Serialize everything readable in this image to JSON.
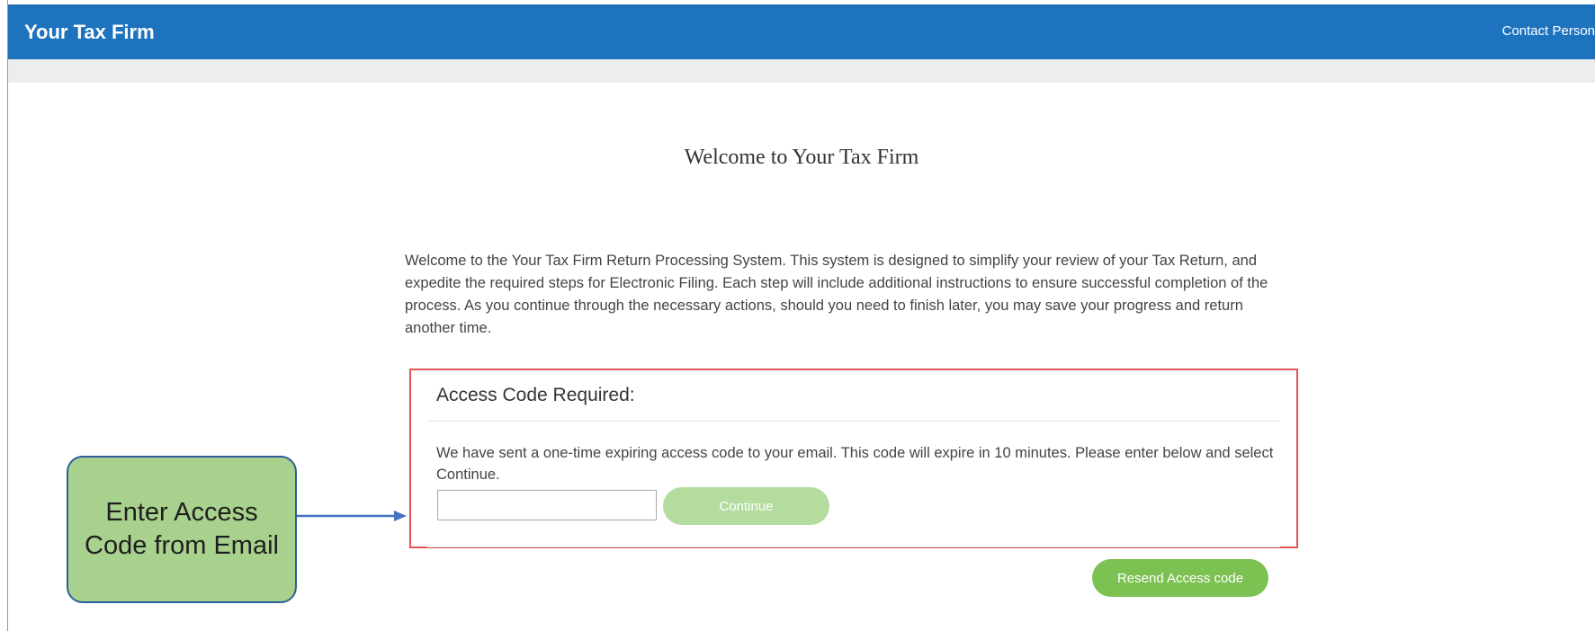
{
  "header": {
    "brand": "Your Tax Firm",
    "contact_link": "Contact Person"
  },
  "main": {
    "title": "Welcome to Your Tax Firm",
    "intro": "Welcome to the Your Tax Firm Return Processing System.  This system is designed to simplify your review of your Tax Return, and expedite the required steps for Electronic Filing.  Each step will include additional instructions to ensure successful completion of the process.  As you continue through the necessary actions, should you need to finish later, you may save your progress and return another time."
  },
  "access": {
    "title": "Access Code Required:",
    "message": "We have sent a one-time expiring access code to your email. This code will expire in 10 minutes. Please enter below and select Continue.",
    "code_value": "",
    "continue_label": "Continue",
    "resend_label": "Resend Access code"
  },
  "callout": {
    "text": "Enter Access Code from Email"
  },
  "colors": {
    "header_blue": "#1e73be",
    "continue_disabled_green": "#b4dc9e",
    "resend_green": "#7cc252",
    "highlight_red": "#e05454",
    "callout_green": "#a9d18e",
    "callout_border": "#2d5f9a",
    "arrow_blue": "#4472c4"
  },
  "icons": {
    "arrow": "arrow-right-icon"
  }
}
